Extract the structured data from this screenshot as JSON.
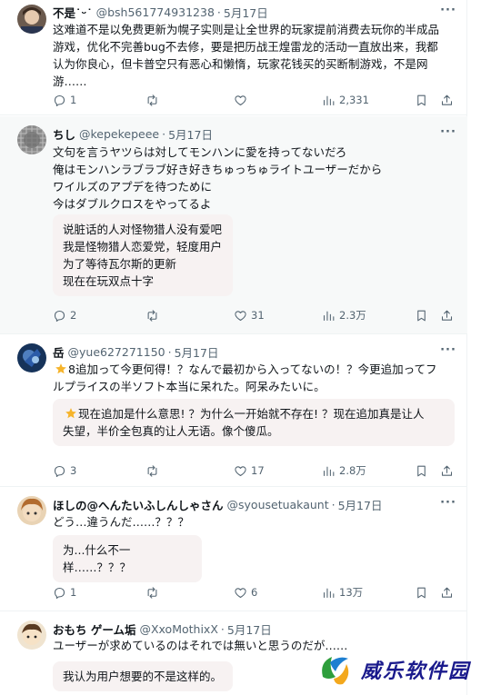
{
  "tweets": [
    {
      "name": "不是˙ᵕ˙",
      "handle": "@bsh561774931238",
      "date": "5月17日",
      "text": "这难道不是以免费更新为幌子实则是让全世界的玩家提前消费去玩你的半成品\n游戏，优化不完善bug不去修，要是把历战王煌雷龙的活动一直放出来，我都\n认为你良心，但卡普空只有恶心和懒惰，玩家花钱买的买断制游戏，不是网\n游……",
      "translation": "",
      "replies": "1",
      "retweets": "",
      "likes": "",
      "views": "2,331"
    },
    {
      "name": "ちし",
      "handle": "@kepekepeee",
      "date": "5月17日",
      "text": "文句を言うヤツらは対してモンハンに愛を持ってないだろ\n俺はモンハンラブラブ好き好きちゅっちゅライトユーザーだから\nワイルズのアプデを待つために\n今はダブルクロスをやってるよ",
      "translation": "说脏话的人对怪物猎人没有爱吧\n我是怪物猎人恋爱党，轻度用户\n为了等待瓦尔斯的更新\n现在在玩双点十字",
      "replies": "2",
      "retweets": "",
      "likes": "31",
      "views": "2.3万"
    },
    {
      "name": "岳",
      "handle": "@yue627271150",
      "date": "5月17日",
      "text": "8追加って今更何得！？なんで最初から入ってないの！？今更追加ってフ\nルプライスの半ソフト本当に呆れた。阿呆みたいに。",
      "translation": "现在追加是什么意思! ？为什么一开始就不存在! ？现在追加真是让人\n失望，半价全包真的让人无语。像个傻瓜。",
      "replies": "3",
      "retweets": "",
      "likes": "17",
      "views": "2.8万"
    },
    {
      "name": "ほしの@へんたいふしんしゃさん",
      "handle": "@syousetuakaunt",
      "date": "5月17日",
      "text": "どう…違うんだ……？？？",
      "translation": "为...什么不一样……？？？",
      "replies": "1",
      "retweets": "",
      "likes": "6",
      "views": "13万"
    },
    {
      "name": "おもち ゲーム垢",
      "handle": "@XxoMothixX",
      "date": "5月17日",
      "text": "ユーザーが求めているのはそれでは無いと思うのだが……",
      "translation": "我认为用户想要的不是这样的。",
      "replies": "",
      "retweets": "",
      "likes": "",
      "views": ""
    }
  ],
  "separator": "·",
  "more_glyph": "···",
  "icons": {
    "reply": "reply-icon",
    "retweet": "retweet-icon",
    "like": "heart-icon",
    "views": "views-icon",
    "bookmark": "bookmark-icon",
    "share": "share-icon",
    "emoji": "star-emoji"
  },
  "watermark": {
    "text": "威乐软件园"
  },
  "colors": {
    "text": "#0f1419",
    "secondary": "#536471",
    "translation_bg": "#f7f2f2",
    "divider": "#eff3f4",
    "selected_bg": "#f7f9f9",
    "watermark": "#1a1a8c"
  }
}
